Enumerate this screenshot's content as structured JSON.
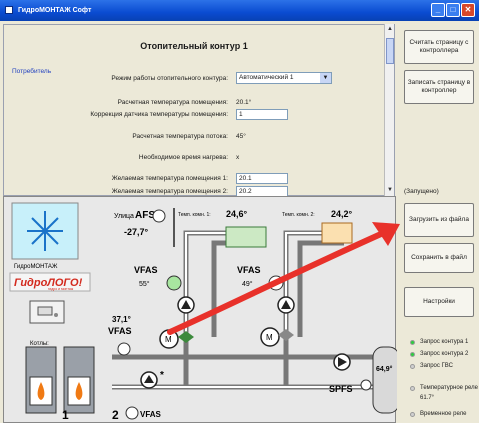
{
  "window": {
    "title": "ГидроМОНТАЖ Софт"
  },
  "panel": {
    "title": "Отопительный контур 1",
    "group_label": "Потребитель",
    "fields": [
      {
        "label": "Режим работы отопительного контура:",
        "value": "Автоматический 1",
        "kind": "select"
      },
      {
        "label": "Расчетная температура помещения:",
        "value": "20.1°",
        "kind": "text"
      },
      {
        "label": "Коррекция датчика температуры помещения:",
        "value": "1",
        "kind": "input"
      },
      {
        "label": "Расчетная температура потока:",
        "value": "45°",
        "kind": "text"
      },
      {
        "label": "Необходимое время нагрева:",
        "value": "x",
        "kind": "text"
      },
      {
        "label": "Желаемая температура помещения 1:",
        "value": "20.1",
        "kind": "input"
      },
      {
        "label": "Желаемая температура помещения 2:",
        "value": "20.2",
        "kind": "input"
      }
    ]
  },
  "right_panel": {
    "buttons": [
      {
        "label": "Считать страницу с контроллера"
      },
      {
        "label": "Записать страницу в контроллер"
      },
      {
        "label": "Загрузить из файла"
      },
      {
        "label": "Сохранить в файл"
      },
      {
        "label": "Настройки"
      }
    ],
    "status": "(Запущено)",
    "legend": [
      {
        "label": "Запрос контура 1",
        "color": "#2ecc40"
      },
      {
        "label": "Запрос контура 2",
        "color": "#2ecc40"
      },
      {
        "label": "Запрос ГВС",
        "color": "#d0d0d0"
      },
      {
        "label": "Температурное реле",
        "color": "#d0d0d0"
      },
      {
        "label": "61.7°",
        "color": ""
      },
      {
        "label": "Временное реле",
        "color": "#d0d0d0"
      }
    ]
  },
  "diagram": {
    "logo_caption": "ГидроМОНТАЖ",
    "logo_brand": "ГидроЛОГО!",
    "logo_tagline": "гидро и монтаж",
    "boilers_label": "Котлы:",
    "street_label": "Улица",
    "afs_label": "AFS",
    "afs_temp": "-27,7°",
    "room1_label": "Темп. комн. 1:",
    "room1_temp": "24,6°",
    "room2_label": "Темп. комн. 2:",
    "room2_temp": "24,2°",
    "vfas1_label": "VFAS",
    "vfas1_temp": "55°",
    "vfas2_label": "VFAS",
    "vfas2_temp": "49°",
    "vfas3_temp": "37,1°",
    "vfas3_label": "VFAS",
    "vfas4_label": "VFAS",
    "spfs_label": "SPFS",
    "tank_temp": "64,9°",
    "motor_label": "M",
    "num1": "1",
    "num2": "2",
    "star": "*"
  },
  "colors": {
    "accent_arrow": "#e8312a",
    "title_blue": "#0a4bd1"
  }
}
